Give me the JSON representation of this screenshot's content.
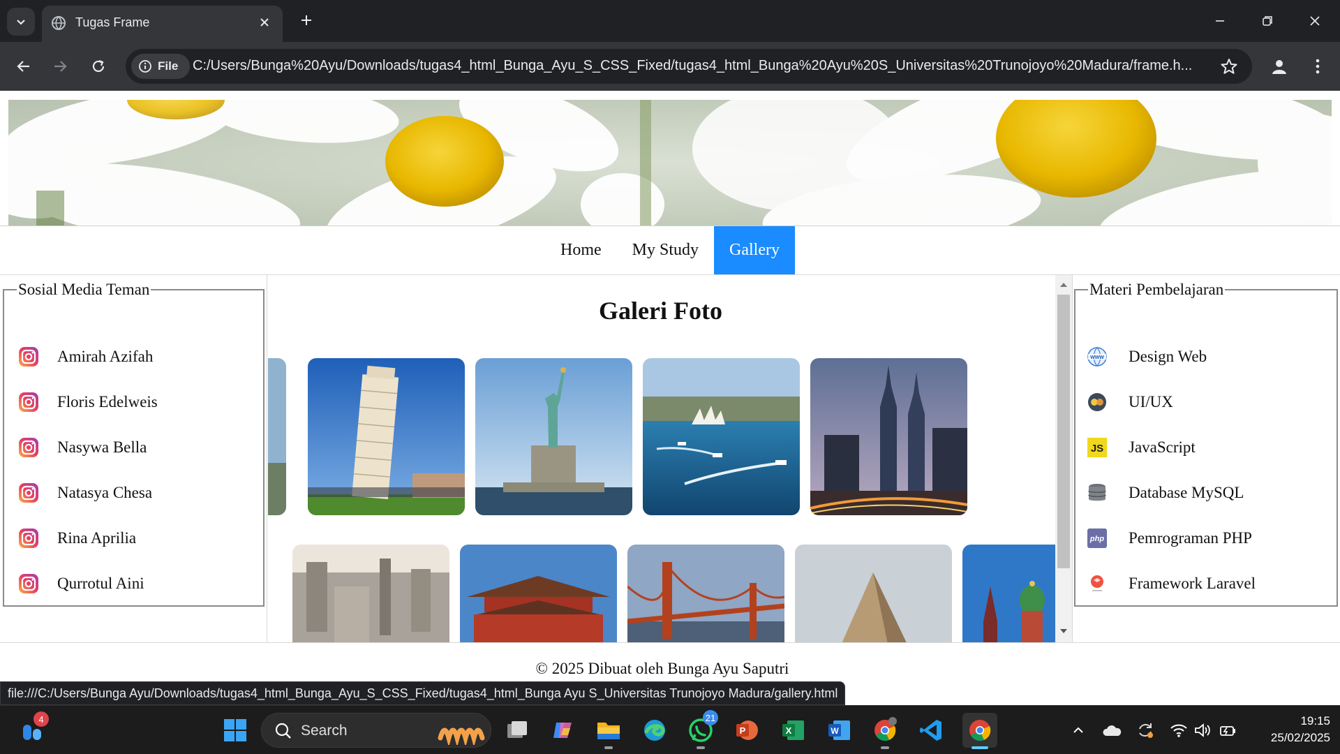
{
  "browser": {
    "tab_title": "Tugas Frame",
    "file_chip_label": "File",
    "url": "C:/Users/Bunga%20Ayu/Downloads/tugas4_html_Bunga_Ayu_S_CSS_Fixed/tugas4_html_Bunga%20Ayu%20S_Universitas%20Trunojoyo%20Madura/frame.h...",
    "status_url": "file:///C:/Users/Bunga Ayu/Downloads/tugas4_html_Bunga_Ayu_S_CSS_Fixed/tugas4_html_Bunga Ayu S_Universitas Trunojoyo Madura/gallery.html"
  },
  "nav": {
    "items": [
      {
        "label": "Home",
        "active": false
      },
      {
        "label": "My Study",
        "active": false
      },
      {
        "label": "Gallery",
        "active": true
      }
    ]
  },
  "left_panel": {
    "legend": "Sosial Media Teman",
    "items": [
      {
        "label": "Amirah Azifah",
        "icon": "instagram-icon"
      },
      {
        "label": "Floris Edelweis",
        "icon": "instagram-icon"
      },
      {
        "label": "Nasywa Bella",
        "icon": "instagram-icon"
      },
      {
        "label": "Natasya Chesa",
        "icon": "instagram-icon"
      },
      {
        "label": "Rina Aprilia",
        "icon": "instagram-icon"
      },
      {
        "label": "Qurrotul Aini",
        "icon": "instagram-icon"
      }
    ]
  },
  "main": {
    "title": "Galeri Foto",
    "photos_row1": [
      "partial-photo",
      "leaning-tower-of-pisa",
      "statue-of-liberty",
      "sydney-harbour",
      "petronas-towers"
    ],
    "photos_row2": [
      "london-skyline",
      "forbidden-city",
      "golden-gate-bridge",
      "pyramid",
      "st-basils-cathedral"
    ]
  },
  "right_panel": {
    "legend": "Materi Pembelajaran",
    "items": [
      {
        "label": "Design Web",
        "icon": "www-globe-icon"
      },
      {
        "label": "UI/UX",
        "icon": "uiux-icon"
      },
      {
        "label": "JavaScript",
        "icon": "javascript-icon"
      },
      {
        "label": "Database MySQL",
        "icon": "database-icon"
      },
      {
        "label": "Pemrograman PHP",
        "icon": "php-icon"
      },
      {
        "label": "Framework Laravel",
        "icon": "laravel-icon"
      }
    ]
  },
  "footer": {
    "text": "© 2025 Dibuat oleh Bunga Ayu Saputri"
  },
  "taskbar": {
    "search_label": "Search",
    "widgets_badge": "4",
    "whatsapp_badge": "21",
    "time": "19:15",
    "date": "25/02/2025"
  },
  "colors": {
    "nav_active": "#1a8cff",
    "browser_dark": "#202124",
    "browser_toolbar": "#35363a"
  }
}
